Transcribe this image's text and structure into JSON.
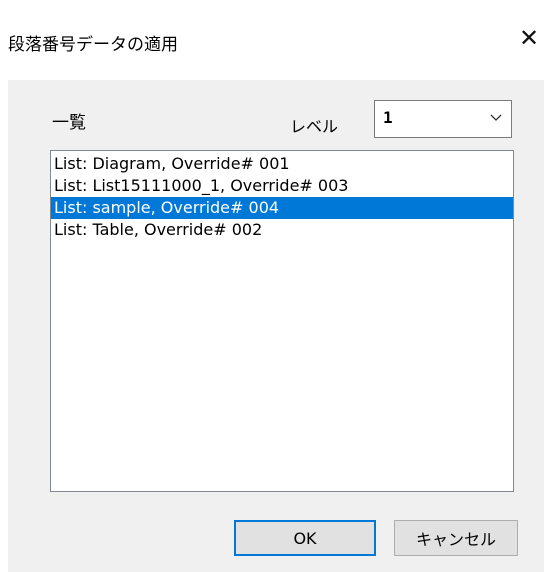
{
  "window": {
    "title": "段落番号データの適用",
    "close_symbol": "✕"
  },
  "list_section": {
    "label": "一覧",
    "level_label": "レベル",
    "level_value": "1",
    "items": [
      {
        "text": "List: Diagram, Override# 001",
        "selected": false
      },
      {
        "text": "List: List15111000_1, Override# 003",
        "selected": false
      },
      {
        "text": "List: sample, Override# 004",
        "selected": true
      },
      {
        "text": "List: Table, Override# 002",
        "selected": false
      }
    ]
  },
  "buttons": {
    "ok": "OK",
    "cancel": "キャンセル"
  },
  "colors": {
    "selection": "#0078d7",
    "dialog_bg": "#f0f0f0"
  },
  "icons": {
    "close": "close-icon",
    "dropdown": "chevron-down-icon"
  }
}
